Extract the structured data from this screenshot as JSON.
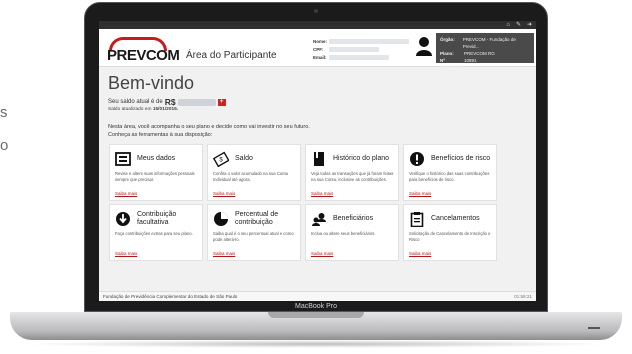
{
  "page_side_text": [
    "s",
    "o"
  ],
  "device": {
    "label": "MacBook Pro"
  },
  "topbar": {
    "icons": [
      "home-icon",
      "wrench-icon",
      "logout-icon"
    ]
  },
  "header": {
    "logo": "PREVCOM",
    "area_title": "Área do Participante",
    "user_fields": [
      {
        "label": "Nome:"
      },
      {
        "label": "CPF:"
      },
      {
        "label": "Email:"
      }
    ],
    "info_panel": [
      {
        "label": "Órgão:",
        "value": "PREVCOM - Fundação de Previd..."
      },
      {
        "label": "Plano:",
        "value": "PREVCOM RG"
      },
      {
        "label": "Nº Inscrição:",
        "value": "10891"
      }
    ]
  },
  "main": {
    "welcome": "Bem-vindo",
    "saldo_prefix": "Seu saldo atual é de",
    "saldo_currency": "R$",
    "saldo_btn": "+",
    "saldo_updated_prefix": "Saldo atualizado em",
    "saldo_updated_date": "15/01/2015.",
    "intro_line1": "Nesta área, você acompanha o seu plano e decide como vai investir no seu futuro.",
    "intro_line2": "Conheça as ferramentas à sua disposição:"
  },
  "cards": [
    {
      "id": "meus-dados",
      "title": "Meus dados",
      "desc": "Revise e altere suas informações pessoais sempre que precisar.",
      "link": "Saiba mais",
      "icon": "id-card-icon"
    },
    {
      "id": "saldo",
      "title": "Saldo",
      "desc": "Confira o valor acumulado na sua Conta Individual até agora.",
      "link": "Saiba mais",
      "icon": "money-icon"
    },
    {
      "id": "historico",
      "title": "Histórico do plano",
      "desc": "Veja todas as transações que já foram feitas na sua Conta, inclusive as contribuições.",
      "link": "Saiba mais",
      "icon": "book-icon"
    },
    {
      "id": "beneficios-risco",
      "title": "Benefícios de risco",
      "desc": "Verifique o histórico das suas contribuições para benefícios de risco.",
      "link": "Saiba mais",
      "icon": "alert-icon"
    },
    {
      "id": "contribuicao-facultativa",
      "title": "Contribuição facultativa",
      "desc": "Faça contribuições extras para seu plano.",
      "link": "Saiba mais",
      "icon": "down-arrow-circle-icon"
    },
    {
      "id": "percentual",
      "title": "Percentual de contribuição",
      "desc": "Saiba qual é o seu percentual atual e como pode alterá-lo.",
      "link": "Saiba mais",
      "icon": "pie-chart-icon"
    },
    {
      "id": "beneficiarios",
      "title": "Beneficiários",
      "desc": "Inclua ou altere seus beneficiários.",
      "link": "Saiba mais",
      "icon": "users-icon"
    },
    {
      "id": "cancelamentos",
      "title": "Cancelamentos",
      "desc": "Solicitação de Cancelamento de Inscrição e Risco",
      "link": "Saiba mais",
      "icon": "clipboard-icon"
    }
  ],
  "footer": {
    "left": "Fundação de Previdência Complementar do Estado de São Paulo",
    "right": "01:59:21"
  },
  "colors": {
    "brand_red": "#c81c1c",
    "topbar": "#2f2f2f",
    "link": "#b01818"
  }
}
